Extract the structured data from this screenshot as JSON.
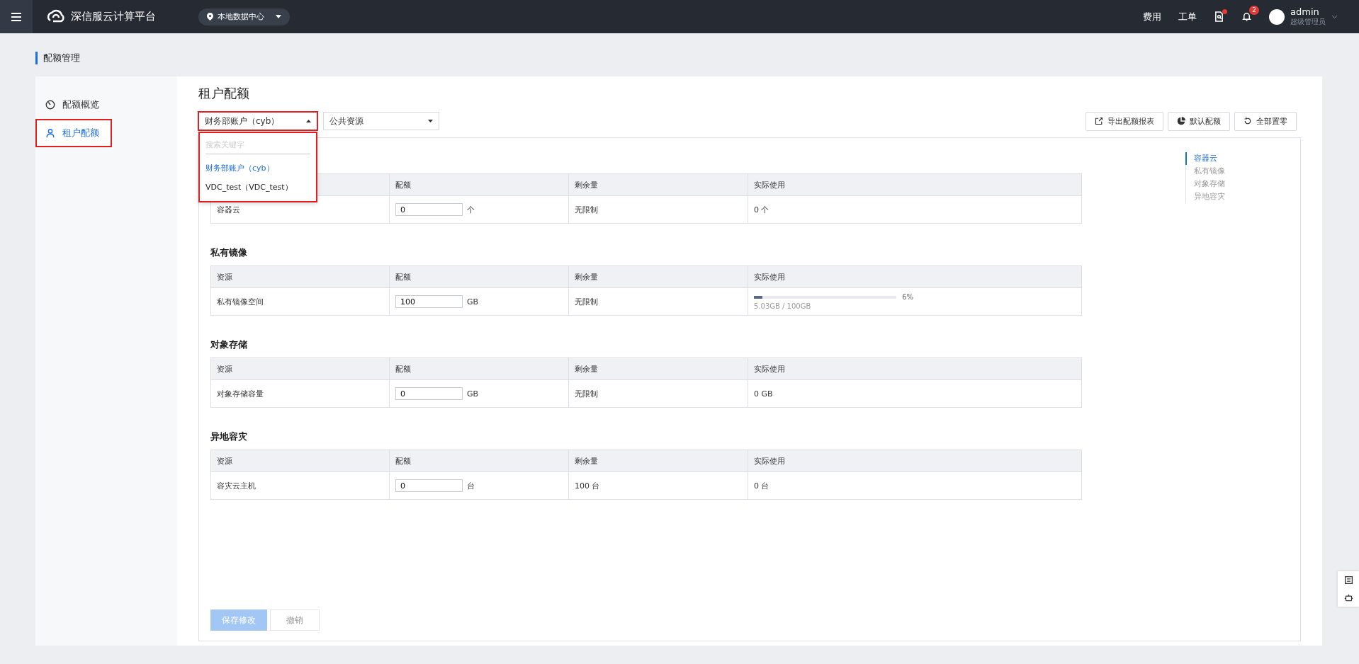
{
  "topbar": {
    "brand": "深信服云计算平台",
    "location": "本地数据中心",
    "links": [
      "费用",
      "工单"
    ],
    "doc_alert": true,
    "notifications": "2",
    "user": {
      "name": "admin",
      "role": "超级管理员"
    }
  },
  "page_title": "配额管理",
  "sidebar": {
    "items": [
      {
        "label": "配额概览",
        "selected": false,
        "highlighted": false
      },
      {
        "label": "租户配额",
        "selected": true,
        "highlighted": true
      }
    ]
  },
  "heading": "租户配额",
  "tenant_select": {
    "value": "财务部账户（cyb）",
    "expanded": true,
    "highlighted": true,
    "search_placeholder": "搜索关键字",
    "options": [
      {
        "label": "财务部账户（cyb）",
        "selected": true
      },
      {
        "label": "VDC_test（VDC_test）",
        "selected": false
      }
    ]
  },
  "resource_select": {
    "value": "公共资源"
  },
  "actions": [
    "导出配额报表",
    "默认配额",
    "全部置零"
  ],
  "sections": [
    {
      "columns": [
        "配额",
        "剩余量",
        "实际使用"
      ],
      "rows": [
        {
          "resource": "容器云",
          "quota": "0",
          "unit": "个",
          "remaining": "无限制",
          "usage": {
            "kind": "text",
            "text": "0 个"
          }
        }
      ]
    },
    {
      "title": "私有镜像",
      "columns": [
        "资源",
        "配额",
        "剩余量",
        "实际使用"
      ],
      "rows": [
        {
          "resource": "私有镜像空间",
          "quota": "100",
          "unit": "GB",
          "remaining": "无限制",
          "usage": {
            "kind": "bar",
            "level": 0.06,
            "percent": "6%",
            "text": "5.03GB / 100GB"
          }
        }
      ]
    },
    {
      "title": "对象存储",
      "columns": [
        "资源",
        "配额",
        "剩余量",
        "实际使用"
      ],
      "rows": [
        {
          "resource": "对象存储容量",
          "quota": "0",
          "unit": "GB",
          "remaining": "无限制",
          "usage": {
            "kind": "text",
            "text": "0 GB"
          }
        }
      ]
    },
    {
      "title": "异地容灾",
      "columns": [
        "资源",
        "配额",
        "剩余量",
        "实际使用"
      ],
      "rows": [
        {
          "resource": "容灾云主机",
          "quota": "0",
          "unit": "台",
          "remaining": "100 台",
          "usage": {
            "kind": "text",
            "text": "0 台"
          }
        }
      ]
    }
  ],
  "anchors": [
    {
      "label": "容器云",
      "selected": true
    },
    {
      "label": "私有镜像",
      "selected": false
    },
    {
      "label": "对象存储",
      "selected": false
    },
    {
      "label": "异地容灾",
      "selected": false
    }
  ],
  "footer": {
    "save": {
      "label": "保存修改",
      "disabled": true
    },
    "cancel": {
      "label": "撤销"
    }
  }
}
